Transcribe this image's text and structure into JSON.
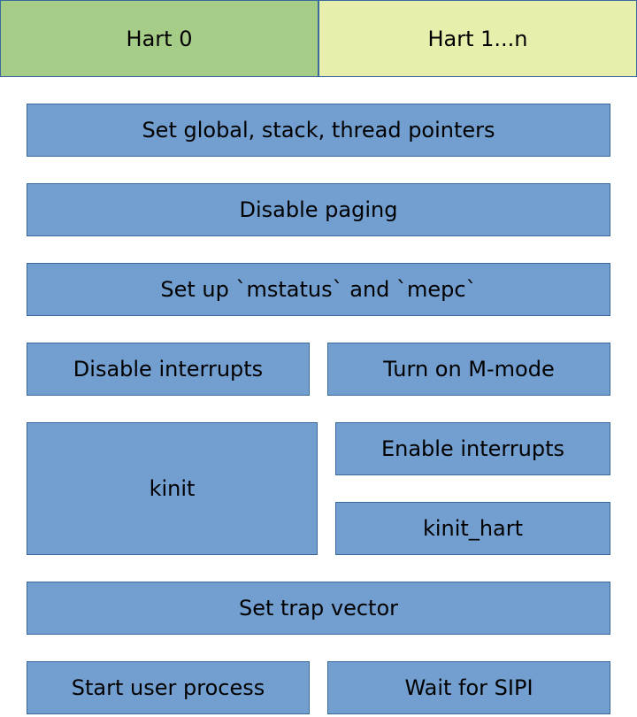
{
  "header": {
    "hart0": "Hart 0",
    "hart1n": "Hart 1...n"
  },
  "rows": {
    "set_pointers": "Set global, stack, thread pointers",
    "disable_paging": "Disable paging",
    "setup_mstatus": "Set up `mstatus` and `mepc`",
    "disable_interrupts": "Disable interrupts",
    "turn_on_mmode": "Turn on M-mode",
    "kinit": "kinit",
    "enable_interrupts": "Enable interrupts",
    "kinit_hart": "kinit_hart",
    "set_trap_vector": "Set trap vector",
    "start_user_process": "Start user process",
    "wait_for_sipi": "Wait for SIPI"
  }
}
